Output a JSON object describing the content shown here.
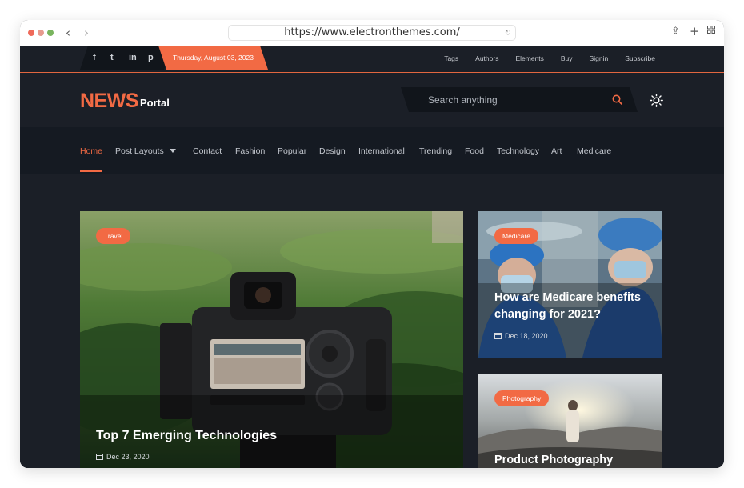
{
  "browser": {
    "url": "https://www.electronthemes.com/"
  },
  "topbar": {
    "social": [
      "f",
      "t",
      "in",
      "p"
    ],
    "date": "Thursday, August 03, 2023",
    "links": [
      "Tags",
      "Authors",
      "Elements",
      "Buy",
      "Signin",
      "Subscribe"
    ]
  },
  "header": {
    "logo_main": "NEWS",
    "logo_sub": "Portal",
    "search_placeholder": "Search anything"
  },
  "nav": {
    "items": [
      "Home",
      "Post Layouts",
      "Contact",
      "Fashion",
      "Popular",
      "Design",
      "International",
      "Trending",
      "Food",
      "Technology",
      "Art",
      "Medicare"
    ],
    "active": "Home"
  },
  "posts": [
    {
      "category": "Travel",
      "title": "Top 7 Emerging Technologies",
      "date": "Dec 23, 2020"
    },
    {
      "category": "Medicare",
      "title_line1": "How are Medicare benefits",
      "title_line2": "changing for 2021?",
      "date": "Dec 18, 2020"
    },
    {
      "category": "Photography",
      "title": "Product Photography"
    }
  ],
  "colors": {
    "accent": "#f26a44",
    "background": "#1b1f27",
    "nav_background": "#151a22"
  }
}
